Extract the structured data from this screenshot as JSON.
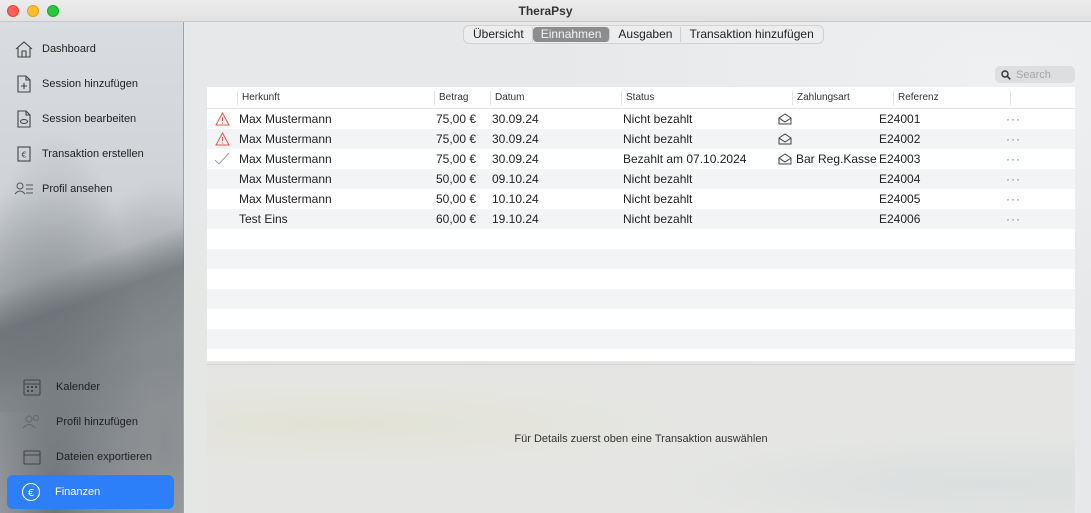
{
  "window": {
    "title": "TheraPsy"
  },
  "sidebar": {
    "top_items": [
      {
        "label": "Dashboard",
        "icon": "house-icon"
      },
      {
        "label": "Session hinzufügen",
        "icon": "doc-plus-icon"
      },
      {
        "label": "Session bearbeiten",
        "icon": "doc-edit-icon"
      },
      {
        "label": "Transaktion erstellen",
        "icon": "euro-doc-icon"
      },
      {
        "label": "Profil ansehen",
        "icon": "person-list-icon"
      }
    ],
    "bottom_items": [
      {
        "label": "Kalender",
        "icon": "calendar-icon"
      },
      {
        "label": "Profil hinzufügen",
        "icon": "person-add-icon"
      },
      {
        "label": "Dateien exportieren",
        "icon": "file-export-icon"
      },
      {
        "label": "Finanzen",
        "icon": "euro-circle-icon",
        "active": true
      }
    ]
  },
  "tabs": [
    {
      "label": "Übersicht",
      "active": false
    },
    {
      "label": "Einnahmen",
      "active": true
    },
    {
      "label": "Ausgaben",
      "active": false
    },
    {
      "label": "Transaktion hinzufügen",
      "active": false
    }
  ],
  "search": {
    "placeholder": "Search"
  },
  "table": {
    "headers": [
      "Herkunft",
      "Betrag",
      "Datum",
      "Status",
      "Zahlungsart",
      "Referenz"
    ],
    "rows": [
      {
        "flag": "warning",
        "herkunft": "Max Mustermann",
        "betrag": "75,00 €",
        "datum": "30.09.24",
        "status": "Nicht bezahlt",
        "mail": true,
        "zahlungsart": "",
        "referenz": "E24001",
        "more": "···"
      },
      {
        "flag": "warning",
        "herkunft": "Max Mustermann",
        "betrag": "75,00 €",
        "datum": "30.09.24",
        "status": "Nicht bezahlt",
        "mail": true,
        "zahlungsart": "",
        "referenz": "E24002",
        "more": "···"
      },
      {
        "flag": "check",
        "herkunft": "Max Mustermann",
        "betrag": "75,00 €",
        "datum": "30.09.24",
        "status": "Bezahlt am 07.10.2024",
        "mail": true,
        "zahlungsart": "Bar Reg.Kasse",
        "referenz": "E24003",
        "more": "···"
      },
      {
        "flag": "",
        "herkunft": "Max Mustermann",
        "betrag": "50,00 €",
        "datum": "09.10.24",
        "status": "Nicht bezahlt",
        "mail": false,
        "zahlungsart": "",
        "referenz": "E24004",
        "more": "···"
      },
      {
        "flag": "",
        "herkunft": "Max Mustermann",
        "betrag": "50,00 €",
        "datum": "10.10.24",
        "status": "Nicht bezahlt",
        "mail": false,
        "zahlungsart": "",
        "referenz": "E24005",
        "more": "···"
      },
      {
        "flag": "",
        "herkunft": "Test Eins",
        "betrag": "60,00 €",
        "datum": "19.10.24",
        "status": "Nicht bezahlt",
        "mail": false,
        "zahlungsart": "",
        "referenz": "E24006",
        "more": "···"
      }
    ],
    "empty_rows": 6
  },
  "detail": {
    "placeholder": "Für Details zuerst oben eine Transaktion auswählen"
  },
  "colors": {
    "accent": "#2d7ff9",
    "warning": "#e5534b",
    "check": "#9a9a9a"
  }
}
